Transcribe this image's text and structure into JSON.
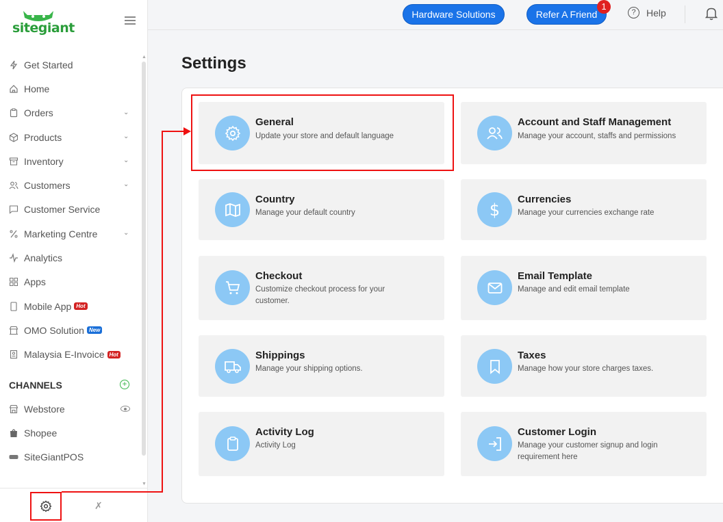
{
  "sidebar": {
    "logo": "sitegiant",
    "items": [
      {
        "label": "Get Started"
      },
      {
        "label": "Home"
      },
      {
        "label": "Orders"
      },
      {
        "label": "Products"
      },
      {
        "label": "Inventory"
      },
      {
        "label": "Customers"
      },
      {
        "label": "Customer Service"
      },
      {
        "label": "Marketing Centre"
      },
      {
        "label": "Analytics"
      },
      {
        "label": "Apps"
      },
      {
        "label": "Mobile App",
        "badge": "Hot"
      },
      {
        "label": "OMO Solution",
        "badge": "New"
      },
      {
        "label": "Malaysia E-Invoice",
        "badge": "Hot"
      }
    ],
    "channels_heading": "CHANNELS",
    "channels": [
      {
        "label": "Webstore"
      },
      {
        "label": "Shopee"
      },
      {
        "label": "SiteGiantPOS"
      }
    ]
  },
  "topbar": {
    "hardware_label": "Hardware Solutions",
    "refer_label": "Refer A Friend",
    "refer_count": "1",
    "help_label": "Help"
  },
  "page": {
    "title": "Settings",
    "cards": [
      {
        "title": "General",
        "desc": "Update your store and default language",
        "icon": "gear-icon"
      },
      {
        "title": "Account and Staff Management",
        "desc": "Manage your account, staffs and permissions",
        "icon": "users-icon"
      },
      {
        "title": "Country",
        "desc": "Manage your default country",
        "icon": "map-icon"
      },
      {
        "title": "Currencies",
        "desc": "Manage your currencies exchange rate",
        "icon": "dollar-icon"
      },
      {
        "title": "Checkout",
        "desc": "Customize checkout process for your customer.",
        "icon": "cart-icon"
      },
      {
        "title": "Email Template",
        "desc": "Manage and edit email template",
        "icon": "mail-icon"
      },
      {
        "title": "Shippings",
        "desc": "Manage your shipping options.",
        "icon": "truck-icon"
      },
      {
        "title": "Taxes",
        "desc": "Manage how your store charges taxes.",
        "icon": "bookmark-icon"
      },
      {
        "title": "Activity Log",
        "desc": "Activity Log",
        "icon": "clipboard-icon"
      },
      {
        "title": "Customer Login",
        "desc": "Manage your customer signup and login requirement here",
        "icon": "login-icon"
      }
    ]
  },
  "colors": {
    "accent": "#1a73e8",
    "icon_circle": "#8cc8f5",
    "highlight": "#ee1111",
    "brand_green": "#2a9d3a"
  }
}
